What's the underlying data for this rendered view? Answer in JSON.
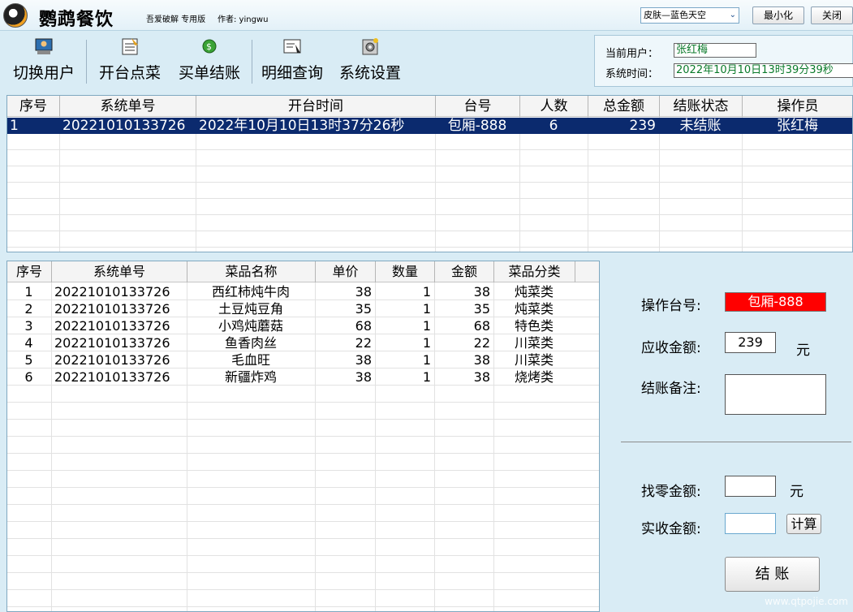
{
  "app": {
    "title": "鹦鹉餐饮",
    "subtitle": "吾爱破解 专用版",
    "author": "作者: yingwu",
    "skin": "皮肤—蓝色天空",
    "minimize": "最小化",
    "close": "关闭"
  },
  "toolbar": [
    {
      "label": "切换用户",
      "icon": "switch-user-icon"
    },
    {
      "label": "开台点菜",
      "icon": "order-icon"
    },
    {
      "label": "买单结账",
      "icon": "checkout-icon"
    },
    {
      "label": "明细查询",
      "icon": "query-icon"
    },
    {
      "label": "系统设置",
      "icon": "settings-icon"
    }
  ],
  "user": {
    "current_label": "当前用户：",
    "current_value": "张红梅",
    "time_label": "系统时间：",
    "time_value": "2022年10月10日13时39分39秒"
  },
  "orders": {
    "headers": [
      "序号",
      "系统单号",
      "开台时间",
      "台号",
      "人数",
      "总金额",
      "结账状态",
      "操作员"
    ],
    "rows": [
      [
        "1",
        "20221010133726",
        "2022年10月10日13时37分26秒",
        "包厢-888",
        "6",
        "239",
        "未结账",
        "张红梅"
      ]
    ]
  },
  "items": {
    "headers": [
      "序号",
      "系统单号",
      "菜品名称",
      "单价",
      "数量",
      "金额",
      "菜品分类"
    ],
    "rows": [
      [
        "1",
        "20221010133726",
        "西红柿炖牛肉",
        "38",
        "1",
        "38",
        "炖菜类"
      ],
      [
        "2",
        "20221010133726",
        "土豆炖豆角",
        "35",
        "1",
        "35",
        "炖菜类"
      ],
      [
        "3",
        "20221010133726",
        "小鸡炖蘑菇",
        "68",
        "1",
        "68",
        "特色类"
      ],
      [
        "4",
        "20221010133726",
        "鱼香肉丝",
        "22",
        "1",
        "22",
        "川菜类"
      ],
      [
        "5",
        "20221010133726",
        "毛血旺",
        "38",
        "1",
        "38",
        "川菜类"
      ],
      [
        "6",
        "20221010133726",
        "新疆炸鸡",
        "38",
        "1",
        "38",
        "烧烤类"
      ]
    ]
  },
  "payment": {
    "table_label": "操作台号:",
    "table_value": "包厢-888",
    "due_label": "应收金额:",
    "due_value": "239",
    "yuan": "元",
    "note_label": "结账备注:",
    "change_label": "找零金额:",
    "paid_label": "实收金额:",
    "calc_button": "计算",
    "checkout_button": "结 账"
  },
  "watermark": "www.qtpojie.com",
  "colors": {
    "accent": "#0b2a6e",
    "highlight": "#ff0000",
    "user_text": "#0a7a2a"
  }
}
